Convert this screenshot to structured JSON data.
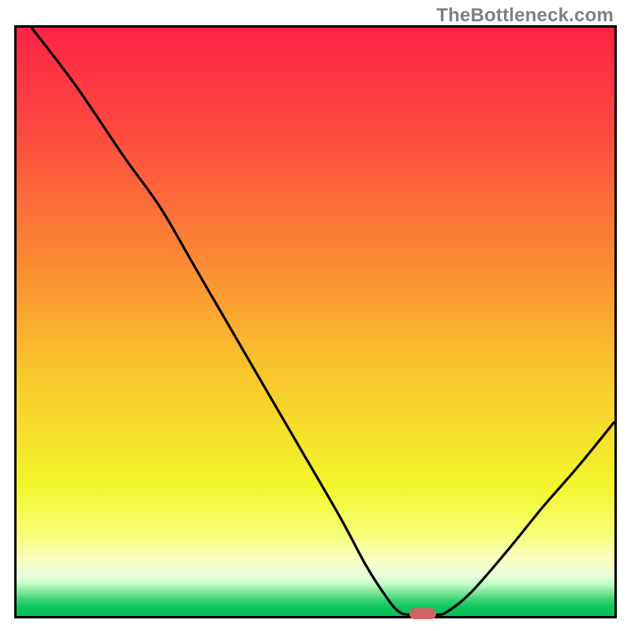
{
  "watermark": "TheBottleneck.com",
  "colors": {
    "curve": "#000000",
    "marker": "#d36363",
    "gradient_stops": [
      {
        "offset": 0.0,
        "color": "#fd2445"
      },
      {
        "offset": 0.18,
        "color": "#fd4b3f"
      },
      {
        "offset": 0.4,
        "color": "#fc8b34"
      },
      {
        "offset": 0.6,
        "color": "#f8ca2b"
      },
      {
        "offset": 0.78,
        "color": "#f3f52c"
      },
      {
        "offset": 0.86,
        "color": "#f6fe76"
      },
      {
        "offset": 0.905,
        "color": "#fafec6"
      },
      {
        "offset": 0.93,
        "color": "#e9feda"
      },
      {
        "offset": 0.945,
        "color": "#c4fcc8"
      },
      {
        "offset": 0.96,
        "color": "#7ce696"
      },
      {
        "offset": 0.975,
        "color": "#2fcf70"
      },
      {
        "offset": 0.985,
        "color": "#10c55e"
      },
      {
        "offset": 1.0,
        "color": "#04c056"
      }
    ]
  },
  "chart_data": {
    "type": "line",
    "title": "",
    "xlabel": "",
    "ylabel": "",
    "x_range": [
      0,
      100
    ],
    "y_range": [
      0,
      100
    ],
    "curve": [
      {
        "x": 2.5,
        "y": 100.0
      },
      {
        "x": 10.0,
        "y": 90.0
      },
      {
        "x": 18.0,
        "y": 78.0
      },
      {
        "x": 24.0,
        "y": 69.5
      },
      {
        "x": 30.0,
        "y": 59.0
      },
      {
        "x": 38.0,
        "y": 45.0
      },
      {
        "x": 46.0,
        "y": 31.0
      },
      {
        "x": 54.0,
        "y": 17.0
      },
      {
        "x": 58.5,
        "y": 8.5
      },
      {
        "x": 62.0,
        "y": 3.0
      },
      {
        "x": 64.0,
        "y": 0.7
      },
      {
        "x": 66.0,
        "y": 0.2
      },
      {
        "x": 70.0,
        "y": 0.2
      },
      {
        "x": 72.0,
        "y": 0.7
      },
      {
        "x": 76.0,
        "y": 4.0
      },
      {
        "x": 82.0,
        "y": 11.0
      },
      {
        "x": 88.0,
        "y": 18.5
      },
      {
        "x": 94.0,
        "y": 25.5
      },
      {
        "x": 100.0,
        "y": 33.0
      }
    ],
    "marker": {
      "x": 68.0,
      "y": 0.0
    }
  }
}
